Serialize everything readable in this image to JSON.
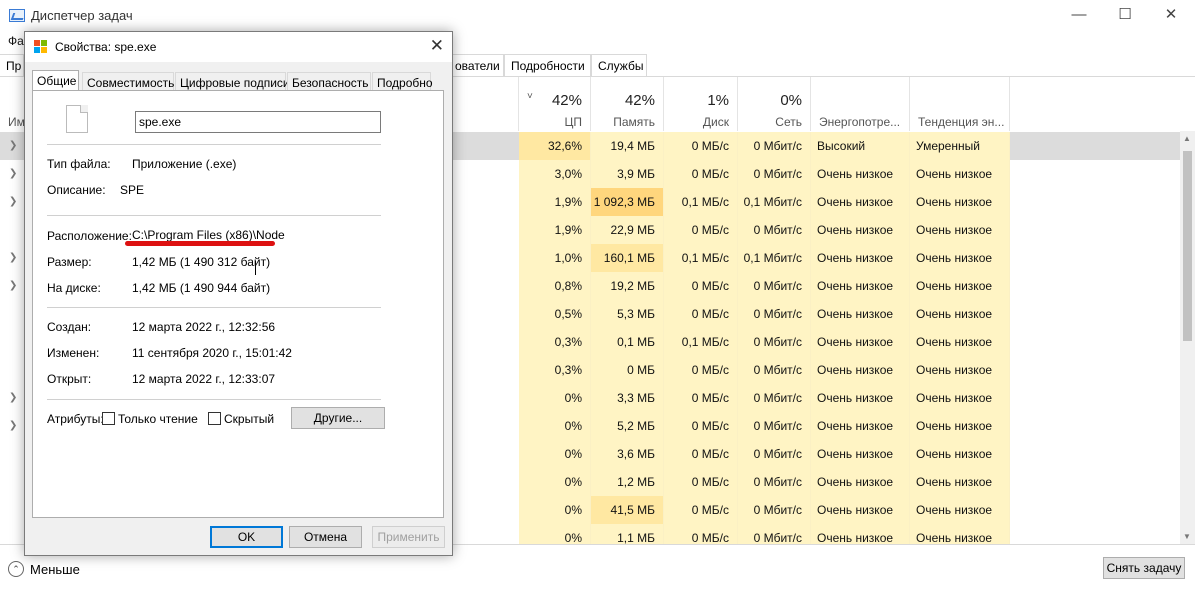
{
  "task_manager": {
    "title": "Диспетчер задач",
    "menu_visible": "Фа",
    "tabs": [
      "Пр",
      "ователи",
      "Подробности",
      "Службы"
    ],
    "name_header_fragment": "Им",
    "columns": [
      {
        "pct": "42%",
        "label": "ЦП"
      },
      {
        "pct": "42%",
        "label": "Память"
      },
      {
        "pct": "1%",
        "label": "Диск"
      },
      {
        "pct": "0%",
        "label": "Сеть"
      },
      {
        "pct": "",
        "label": "Энергопотре..."
      },
      {
        "pct": "",
        "label": "Тенденция эн..."
      }
    ],
    "rows": [
      {
        "cpu": "32,6%",
        "mem": "19,4 МБ",
        "disk": "0 МБ/с",
        "net": "0 Мбит/с",
        "power": "Высокий",
        "trend": "Умеренный",
        "selected": true,
        "expand": true
      },
      {
        "cpu": "3,0%",
        "mem": "3,9 МБ",
        "disk": "0 МБ/с",
        "net": "0 Мбит/с",
        "power": "Очень низкое",
        "trend": "Очень низкое",
        "expand": true
      },
      {
        "cpu": "1,9%",
        "mem": "1 092,3 МБ",
        "disk": "0,1 МБ/с",
        "net": "0,1 Мбит/с",
        "power": "Очень низкое",
        "trend": "Очень низкое",
        "expand": true
      },
      {
        "cpu": "1,9%",
        "mem": "22,9 МБ",
        "disk": "0 МБ/с",
        "net": "0 Мбит/с",
        "power": "Очень низкое",
        "trend": "Очень низкое",
        "expand": false
      },
      {
        "cpu": "1,0%",
        "mem": "160,1 МБ",
        "disk": "0,1 МБ/с",
        "net": "0,1 Мбит/с",
        "power": "Очень низкое",
        "trend": "Очень низкое",
        "expand": true
      },
      {
        "cpu": "0,8%",
        "mem": "19,2 МБ",
        "disk": "0 МБ/с",
        "net": "0 Мбит/с",
        "power": "Очень низкое",
        "trend": "Очень низкое",
        "expand": true
      },
      {
        "cpu": "0,5%",
        "mem": "5,3 МБ",
        "disk": "0 МБ/с",
        "net": "0 Мбит/с",
        "power": "Очень низкое",
        "trend": "Очень низкое",
        "expand": false
      },
      {
        "cpu": "0,3%",
        "mem": "0,1 МБ",
        "disk": "0,1 МБ/с",
        "net": "0 Мбит/с",
        "power": "Очень низкое",
        "trend": "Очень низкое",
        "expand": false
      },
      {
        "cpu": "0,3%",
        "mem": "0 МБ",
        "disk": "0 МБ/с",
        "net": "0 Мбит/с",
        "power": "Очень низкое",
        "trend": "Очень низкое",
        "expand": false
      },
      {
        "cpu": "0%",
        "mem": "3,3 МБ",
        "disk": "0 МБ/с",
        "net": "0 Мбит/с",
        "power": "Очень низкое",
        "trend": "Очень низкое",
        "expand": true
      },
      {
        "cpu": "0%",
        "mem": "5,2 МБ",
        "disk": "0 МБ/с",
        "net": "0 Мбит/с",
        "power": "Очень низкое",
        "trend": "Очень низкое",
        "expand": true
      },
      {
        "cpu": "0%",
        "mem": "3,6 МБ",
        "disk": "0 МБ/с",
        "net": "0 Мбит/с",
        "power": "Очень низкое",
        "trend": "Очень низкое",
        "expand": false
      },
      {
        "cpu": "0%",
        "mem": "1,2 МБ",
        "disk": "0 МБ/с",
        "net": "0 Мбит/с",
        "power": "Очень низкое",
        "trend": "Очень низкое",
        "expand": false
      },
      {
        "cpu": "0%",
        "mem": "41,5 МБ",
        "disk": "0 МБ/с",
        "net": "0 Мбит/с",
        "power": "Очень низкое",
        "trend": "Очень низкое",
        "expand": false
      },
      {
        "cpu": "0%",
        "mem": "1,1 МБ",
        "disk": "0 МБ/с",
        "net": "0 Мбит/с",
        "power": "Очень низкое",
        "trend": "Очень низкое",
        "expand": false
      }
    ],
    "fewer_label": "Меньше",
    "end_task_label": "Снять задачу"
  },
  "dialog": {
    "title": "Свойства: spe.exe",
    "tabs": [
      "Общие",
      "Совместимость",
      "Цифровые подписи",
      "Безопасность",
      "Подробно"
    ],
    "filename": "spe.exe",
    "file_type_label": "Тип файла:",
    "file_type": "Приложение (.exe)",
    "description_label": "Описание:",
    "description": "SPE",
    "location_label": "Расположение:",
    "location": "C:\\Program Files (x86)\\Node",
    "size_label": "Размер:",
    "size": "1,42 МБ (1 490 312 байт)",
    "on_disk_label": "На диске:",
    "on_disk": "1,42 МБ (1 490 944 байт)",
    "created_label": "Создан:",
    "created": "12 марта 2022 г., 12:32:56",
    "modified_label": "Изменен:",
    "modified": "11 сентября 2020 г., 15:01:42",
    "accessed_label": "Открыт:",
    "accessed": "12 марта 2022 г., 12:33:07",
    "attributes_label": "Атрибуты:",
    "readonly_label": "Только чтение",
    "hidden_label": "Скрытый",
    "other_button": "Другие...",
    "ok_button": "OK",
    "cancel_button": "Отмена",
    "apply_button": "Применить"
  },
  "colors": {
    "accent": "#0078d7",
    "heat_light": "#fff4c4",
    "heat_mid": "#ffe8a2",
    "heat_high": "#ffd67d",
    "underline": "#dd1111"
  }
}
